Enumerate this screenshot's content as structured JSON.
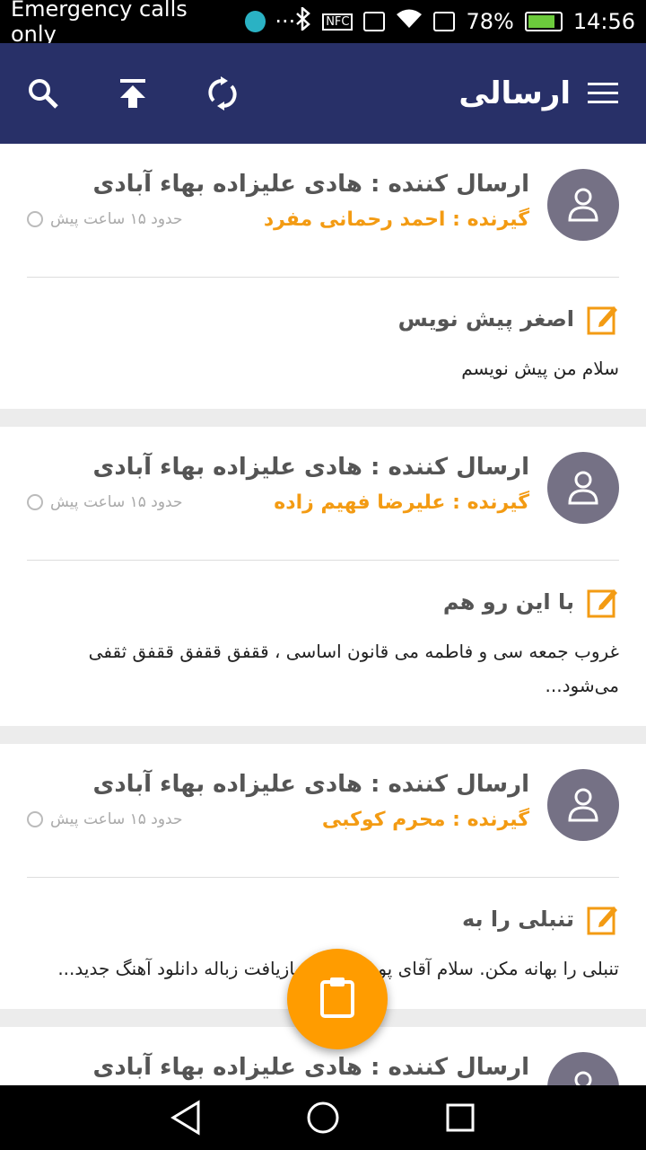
{
  "status_bar": {
    "carrier": "Emergency calls only",
    "dots": "···",
    "nfc": "NFC",
    "battery_percent": "78%",
    "time": "14:56",
    "battery_level": 0.78
  },
  "app_bar": {
    "title": "ارسالی",
    "icons": [
      "menu-icon",
      "search-icon",
      "upload-icon",
      "refresh-icon"
    ]
  },
  "messages": [
    {
      "sender": "ارسال کننده : هادی علیزاده بهاء آبادی",
      "receiver": "گیرنده : احمد رحمانی مفرد",
      "time": "حدود ۱۵ ساعت پیش",
      "subject": "اصغر پیش نویس",
      "text": "سلام من پیش نویسم"
    },
    {
      "sender": "ارسال کننده : هادی علیزاده بهاء آبادی",
      "receiver": "گیرنده : علیرضا فهیم زاده",
      "time": "حدود ۱۵ ساعت پیش",
      "subject": "با این رو هم",
      "text": "غروب جمعه سی و فاطمه می قانون اساسی ، ققفق ققفق ققفق ثقفی می‌شود..."
    },
    {
      "sender": "ارسال کننده : هادی علیزاده بهاء آبادی",
      "receiver": "گیرنده : محرم کوکبی",
      "time": "حدود ۱۵ ساعت پیش",
      "subject": "تنبلی را به",
      "text": "تنبلی را بهانه مکن. سلام آقای پویان سطل بازیافت زباله دانلود آهنگ جدید..."
    },
    {
      "sender": "ارسال کننده : هادی علیزاده بهاء آبادی",
      "receiver": "",
      "time": "",
      "subject": "",
      "text": ""
    }
  ],
  "colors": {
    "app_bar": "#283068",
    "accent": "#f39b13",
    "fab": "#ff9c00",
    "avatar": "#757185"
  }
}
